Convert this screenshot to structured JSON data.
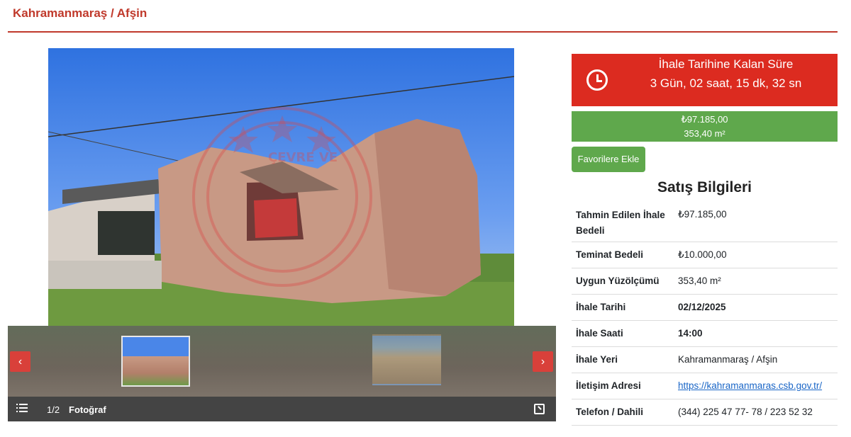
{
  "header": {
    "title": "Kahramanmaraş / Afşin"
  },
  "gallery": {
    "counter": "1/2",
    "label": "Fotoğraf",
    "prev_icon": "chevron-left-icon",
    "next_icon": "chevron-right-icon",
    "list_icon": "list-icon",
    "expand_icon": "expand-icon",
    "watermark": "ÇEVRE VE"
  },
  "countdown": {
    "title": "İhale Tarihine Kalan Süre",
    "time": "3 Gün, 02 saat, 15 dk, 32 sn",
    "icon": "clock-icon",
    "color": "#dc2b20"
  },
  "price": {
    "amount": "₺97.185,00",
    "area": "353,40 m²",
    "color": "#5fa84c"
  },
  "favorite_button": {
    "label": "Favorilere Ekle"
  },
  "sales_info": {
    "title": "Satış Bilgileri",
    "rows": [
      {
        "key": "Tahmin Edilen İhale Bedeli",
        "value": "₺97.185,00"
      },
      {
        "key": "Teminat Bedeli",
        "value": "₺10.000,00"
      },
      {
        "key": "Uygun Yüzölçümü",
        "value": "353,40 m²"
      },
      {
        "key": "İhale Tarihi",
        "value": "02/12/2025"
      },
      {
        "key": "İhale Saati",
        "value": "14:00"
      },
      {
        "key": "İhale Yeri",
        "value": "Kahramanmaraş / Afşin"
      },
      {
        "key": "İletişim Adresi",
        "value": "https://kahramanmaras.csb.gov.tr/"
      },
      {
        "key": "Telefon / Dahili",
        "value": "(344) 225 47 77- 78 / 223 52 32"
      }
    ]
  }
}
